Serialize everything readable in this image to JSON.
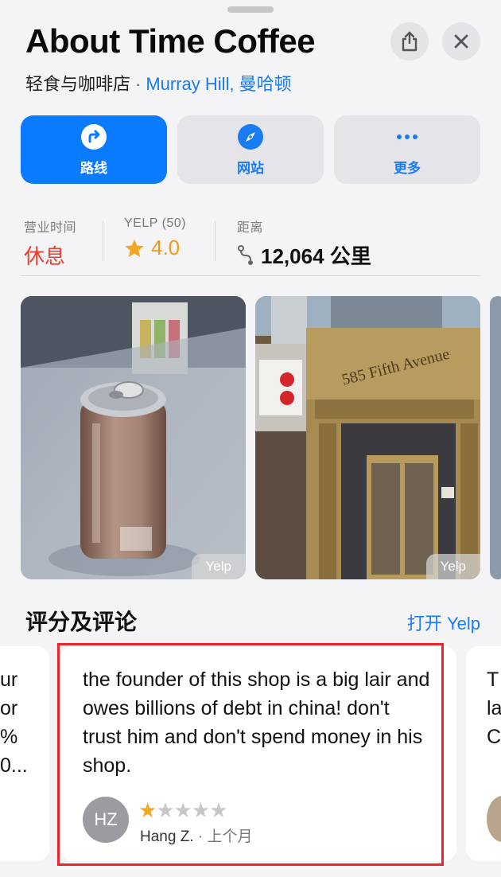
{
  "header": {
    "title": "About Time Coffee",
    "category": "轻食与咖啡店",
    "separator": "·",
    "location": "Murray Hill, 曼哈顿"
  },
  "icons": {
    "share": "share-icon",
    "close": "close-icon",
    "directions": "directions-icon",
    "website": "compass-icon",
    "more": "more-dots-icon",
    "star": "star-icon",
    "distance": "route-icon"
  },
  "actions": [
    {
      "label": "路线"
    },
    {
      "label": "网站"
    },
    {
      "label": "更多"
    }
  ],
  "info": {
    "hours_head": "营业时间",
    "hours_value": "休息",
    "rating_head": "YELP (50)",
    "rating_value": "4.0",
    "distance_head": "距离",
    "distance_value": "12,064 公里"
  },
  "photos": {
    "source_1": "Yelp",
    "source_2": "Yelp",
    "facade_sign": "585 Fifth Avenue"
  },
  "reviews_section": {
    "title": "评分及评论",
    "open_link": "打开 Yelp"
  },
  "reviews": {
    "left_peek": [
      "ur",
      "or",
      "%",
      "0..."
    ],
    "right_peek": [
      "T",
      "la",
      "C"
    ],
    "main": {
      "text": "the founder of this shop is a big lair and owes billions of debt in china! don't trust him and don't spend money in his shop.",
      "initials": "HZ",
      "rating": 1,
      "max_rating": 5,
      "author": "Hang Z.",
      "dot": "·",
      "when": "上个月"
    }
  },
  "colors": {
    "accent": "#0a7aff",
    "closed": "#e8402f",
    "star": "#f5a623",
    "highlight": "#e8262c"
  }
}
